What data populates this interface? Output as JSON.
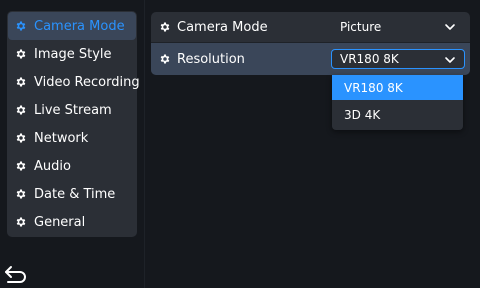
{
  "colors": {
    "accent": "#2a93ff",
    "panel": "#2b2f36",
    "highlight_row": "#3a4659",
    "background": "#15181d"
  },
  "sidebar": {
    "items": [
      {
        "label": "Camera Mode",
        "icon": "gear-icon",
        "active": true
      },
      {
        "label": "Image Style",
        "icon": "gear-icon",
        "active": false
      },
      {
        "label": "Video Recording",
        "icon": "gear-icon",
        "active": false
      },
      {
        "label": "Live Stream",
        "icon": "gear-icon",
        "active": false
      },
      {
        "label": "Network",
        "icon": "gear-icon",
        "active": false
      },
      {
        "label": "Audio",
        "icon": "gear-icon",
        "active": false
      },
      {
        "label": "Date & Time",
        "icon": "gear-icon",
        "active": false
      },
      {
        "label": "General",
        "icon": "gear-icon",
        "active": false
      }
    ]
  },
  "back": {
    "icon": "back-arrow-icon"
  },
  "settings": {
    "camera_mode": {
      "label": "Camera Mode",
      "value": "Picture",
      "icon": "gear-icon"
    },
    "resolution": {
      "label": "Resolution",
      "value": "VR180 8K",
      "icon": "gear-icon",
      "options": [
        {
          "label": "VR180 8K",
          "selected": true
        },
        {
          "label": "3D 4K",
          "selected": false
        }
      ]
    }
  }
}
